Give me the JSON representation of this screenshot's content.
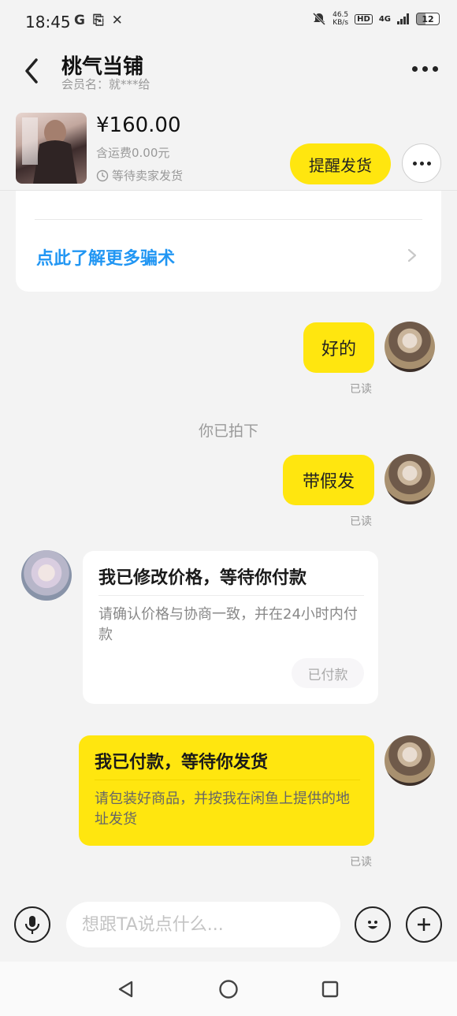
{
  "status_bar": {
    "time": "18:45",
    "left_icons": [
      "G",
      "⎘",
      "✕"
    ],
    "net_speed_value": "46.5",
    "net_speed_unit": "KB/s",
    "hd": "HD",
    "signal": "4G",
    "battery": "12"
  },
  "header": {
    "title": "桃气当铺",
    "subtitle": "会员名：就***给"
  },
  "product": {
    "price": "¥160.00",
    "shipping": "含运费0.00元",
    "status": "等待卖家发货",
    "remind_label": "提醒发货"
  },
  "warning": {
    "link_text": "点此了解更多骗术"
  },
  "messages": {
    "msg1": "好的",
    "read1": "已读",
    "system1": "你已拍下",
    "msg2": "带假发",
    "read2": "已读",
    "card1": {
      "title": "我已修改价格，等待你付款",
      "desc": "请确认价格与协商一致，并在24小时内付款",
      "badge": "已付款"
    },
    "card2": {
      "title": "我已付款，等待你发货",
      "desc": "请包装好商品，并按我在闲鱼上提供的地址发货"
    },
    "read3": "已读"
  },
  "input": {
    "placeholder": "想跟TA说点什么..."
  },
  "colors": {
    "accent_yellow": "#ffe60f",
    "link_blue": "#2196f3",
    "background": "#f3f3f3"
  },
  "icons": [
    "back-arrow-icon",
    "more-icon",
    "clock-icon",
    "chevron-right-icon",
    "microphone-icon",
    "emoji-icon",
    "plus-icon",
    "nav-back-icon",
    "nav-home-icon",
    "nav-recents-icon"
  ]
}
